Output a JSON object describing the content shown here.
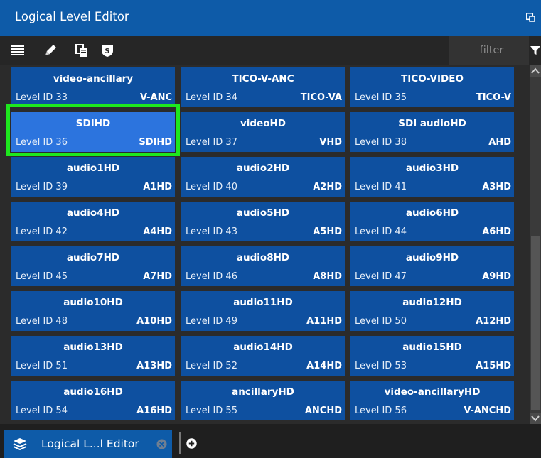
{
  "window": {
    "title": "Logical Level Editor"
  },
  "toolbar": {
    "tools": [
      "list-icon",
      "pencil-icon",
      "copy-icon",
      "shield-icon"
    ],
    "filter_placeholder": "filter"
  },
  "levels": [
    {
      "name": "video-ancillary",
      "id_label": "Level ID 33",
      "abbr": "V-ANC"
    },
    {
      "name": "TICO-V-ANC",
      "id_label": "Level ID 34",
      "abbr": "TICO-VA"
    },
    {
      "name": "TICO-VIDEO",
      "id_label": "Level ID 35",
      "abbr": "TICO-V"
    },
    {
      "name": "SDIHD",
      "id_label": "Level ID 36",
      "abbr": "SDIHD",
      "selected": true
    },
    {
      "name": "videoHD",
      "id_label": "Level ID 37",
      "abbr": "VHD"
    },
    {
      "name": "SDI audioHD",
      "id_label": "Level ID 38",
      "abbr": "AHD"
    },
    {
      "name": "audio1HD",
      "id_label": "Level ID 39",
      "abbr": "A1HD"
    },
    {
      "name": "audio2HD",
      "id_label": "Level ID 40",
      "abbr": "A2HD"
    },
    {
      "name": "audio3HD",
      "id_label": "Level ID 41",
      "abbr": "A3HD"
    },
    {
      "name": "audio4HD",
      "id_label": "Level ID 42",
      "abbr": "A4HD"
    },
    {
      "name": "audio5HD",
      "id_label": "Level ID 43",
      "abbr": "A5HD"
    },
    {
      "name": "audio6HD",
      "id_label": "Level ID 44",
      "abbr": "A6HD"
    },
    {
      "name": "audio7HD",
      "id_label": "Level ID 45",
      "abbr": "A7HD"
    },
    {
      "name": "audio8HD",
      "id_label": "Level ID 46",
      "abbr": "A8HD"
    },
    {
      "name": "audio9HD",
      "id_label": "Level ID 47",
      "abbr": "A9HD"
    },
    {
      "name": "audio10HD",
      "id_label": "Level ID 48",
      "abbr": "A10HD"
    },
    {
      "name": "audio11HD",
      "id_label": "Level ID 49",
      "abbr": "A11HD"
    },
    {
      "name": "audio12HD",
      "id_label": "Level ID 50",
      "abbr": "A12HD"
    },
    {
      "name": "audio13HD",
      "id_label": "Level ID 51",
      "abbr": "A13HD"
    },
    {
      "name": "audio14HD",
      "id_label": "Level ID 52",
      "abbr": "A14HD"
    },
    {
      "name": "audio15HD",
      "id_label": "Level ID 53",
      "abbr": "A15HD"
    },
    {
      "name": "audio16HD",
      "id_label": "Level ID 54",
      "abbr": "A16HD"
    },
    {
      "name": "ancillaryHD",
      "id_label": "Level ID 55",
      "abbr": "ANCHD"
    },
    {
      "name": "video-ancillaryHD",
      "id_label": "Level ID 56",
      "abbr": "V-ANCHD"
    }
  ],
  "tabs": [
    {
      "label": "Logical L...l Editor",
      "icon": "layers-icon"
    }
  ],
  "colors": {
    "accent": "#0e5ba8",
    "tile": "#0e50a0",
    "tile_selected": "#2c74de",
    "highlight": "#1ee81e"
  }
}
